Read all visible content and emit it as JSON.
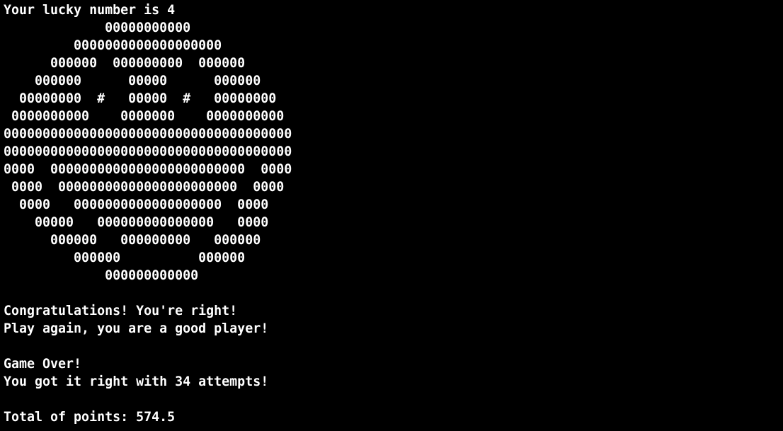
{
  "terminal": {
    "lines": [
      "Your lucky number is 4",
      "             00000000000",
      "         0000000000000000000",
      "      000000  000000000  000000",
      "    000000      00000      000000",
      "  00000000  #   00000  #   00000000",
      " 0000000000    0000000    0000000000",
      "0000000000000000000000000000000000000",
      "0000000000000000000000000000000000000",
      "0000  0000000000000000000000000  0000",
      " 0000  00000000000000000000000  0000",
      "  0000   0000000000000000000  0000",
      "    00000   000000000000000   0000",
      "      000000   000000000   000000",
      "         000000          000000",
      "             000000000000",
      "",
      "Congratulations! You're right!",
      "Play again, you are a good player!",
      "",
      "Game Over!",
      "You got it right with 34 attempts!",
      "",
      "Total of points: 574.5"
    ]
  },
  "colors": {
    "background": "#000000",
    "foreground": "#ffffff"
  }
}
